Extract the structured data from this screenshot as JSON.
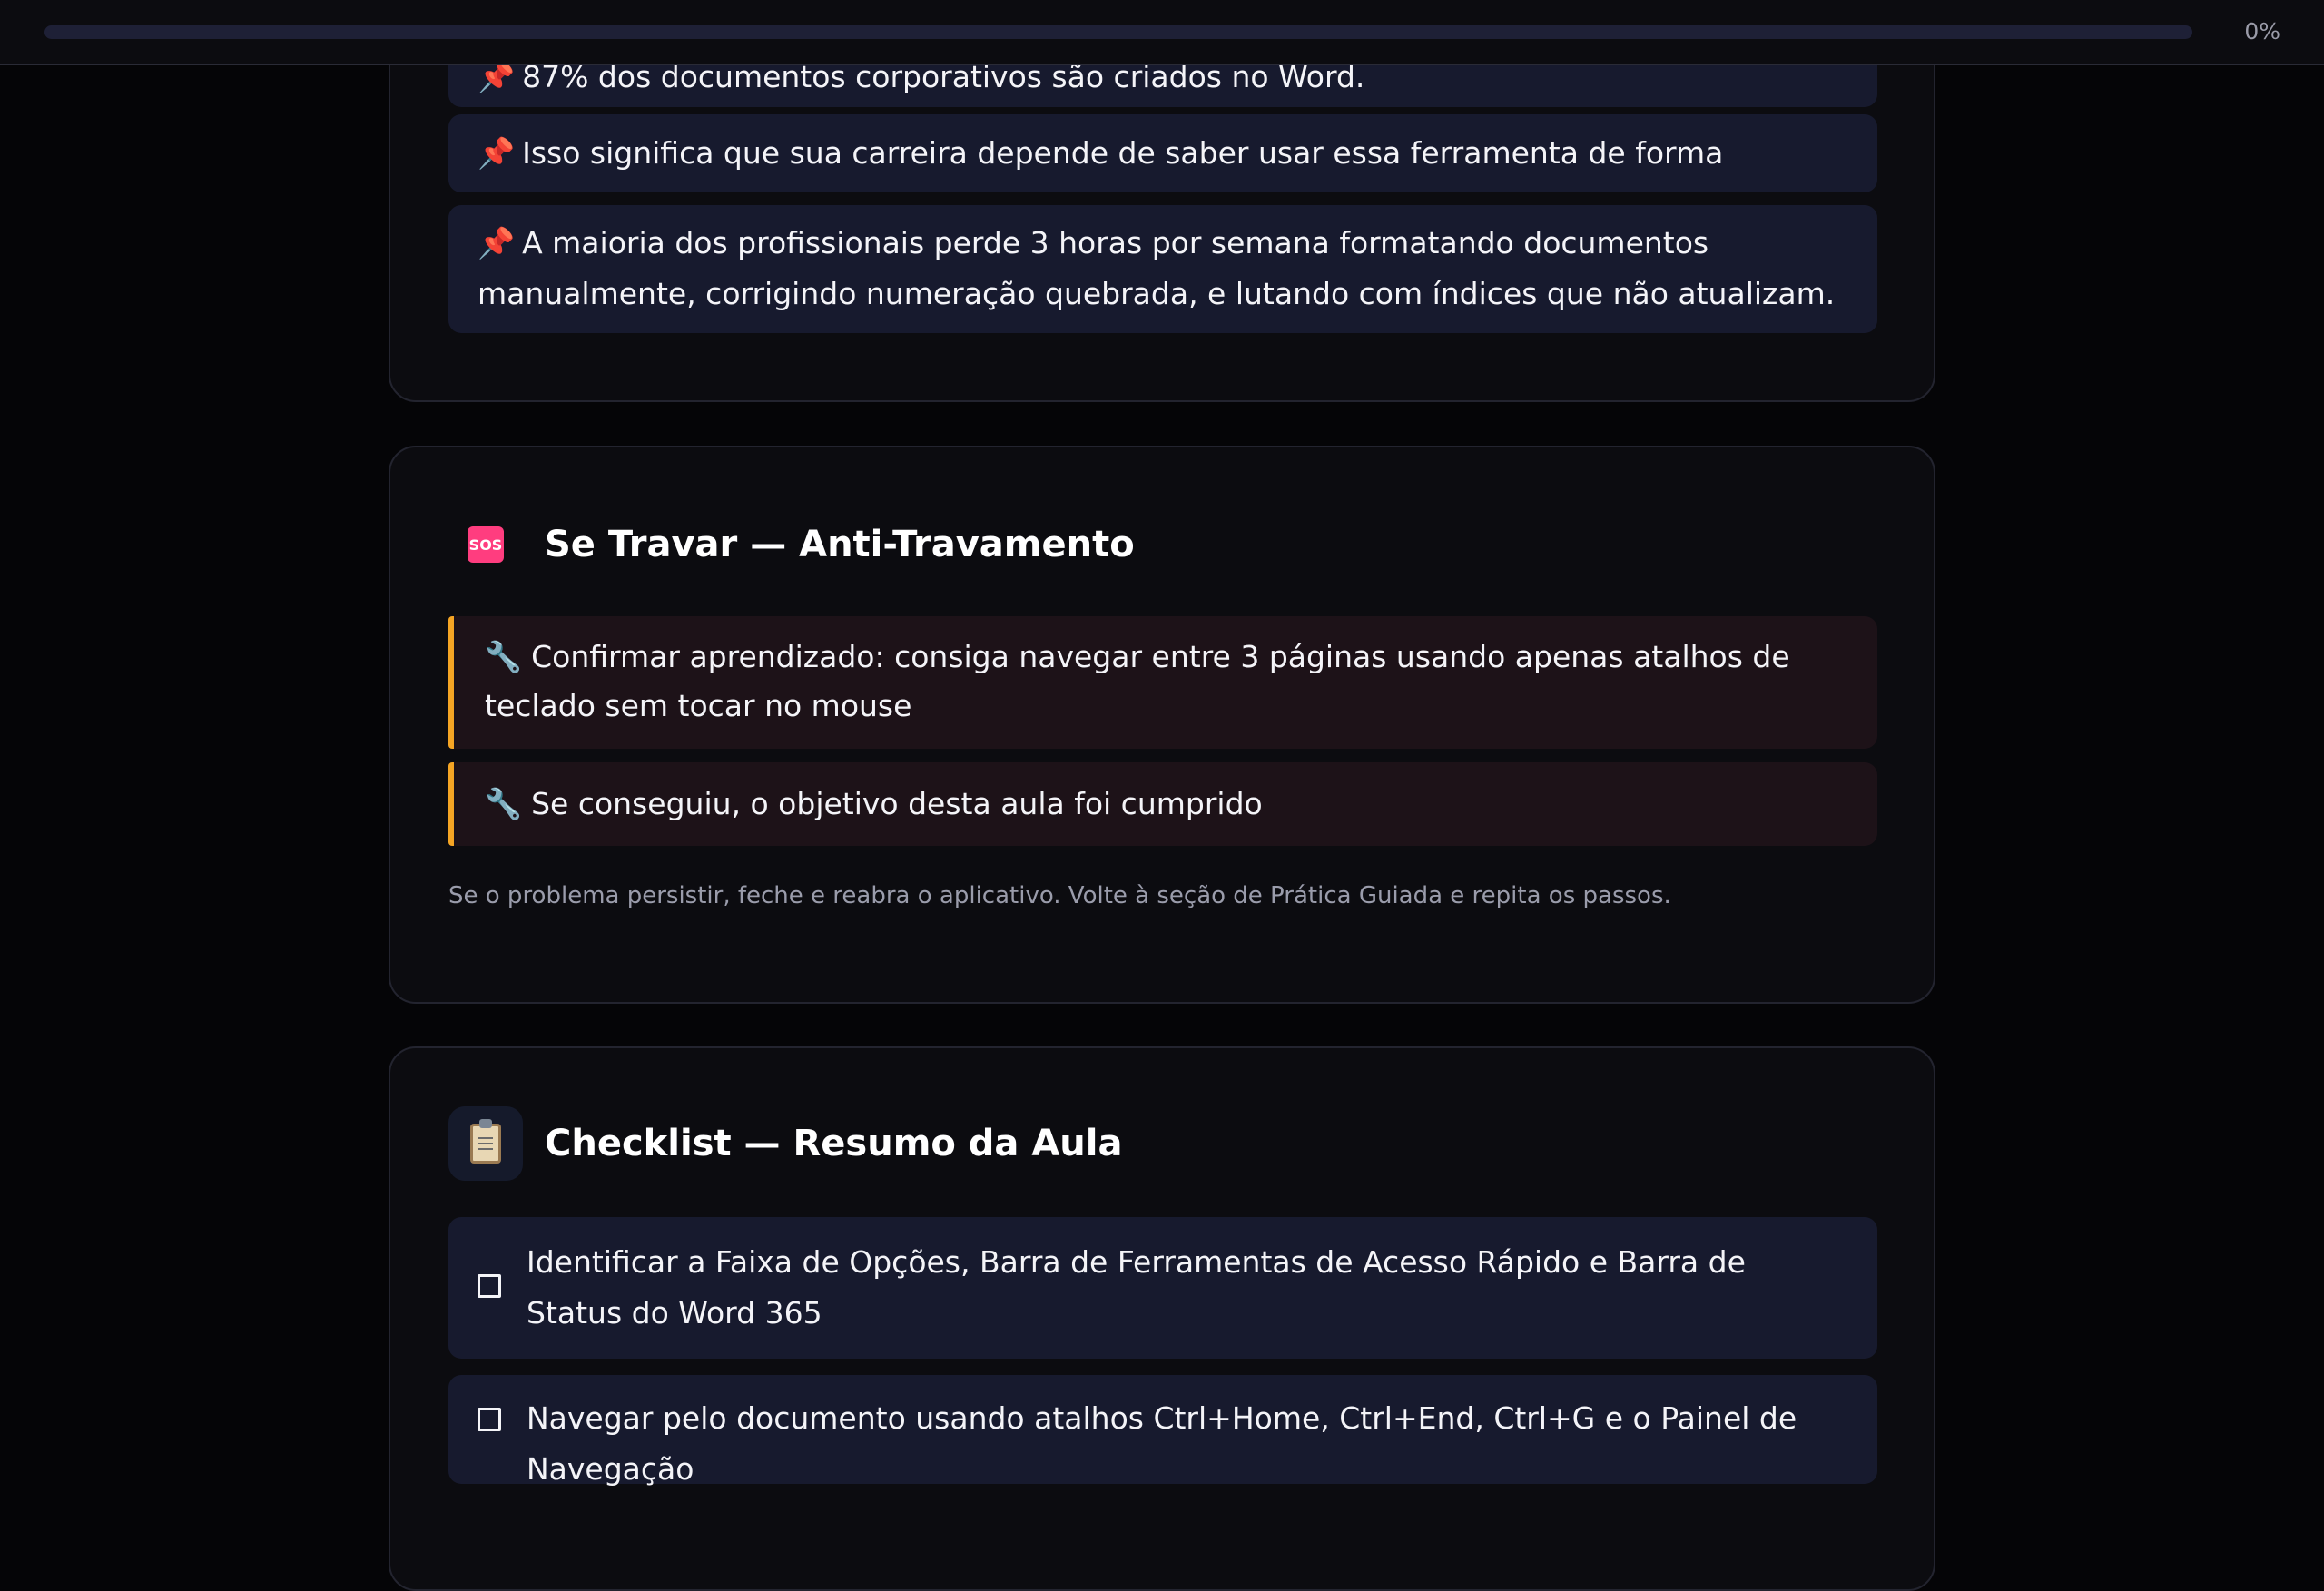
{
  "progress": {
    "percent_label": "0%",
    "value": 0
  },
  "facts": [
    "87% dos documentos corporativos são criados no Word.",
    "Isso significa que sua carreira depende de saber usar essa ferramenta de forma eficiente.",
    "A maioria dos profissionais perde 3 horas por semana formatando documentos manualmente, corrigindo numeração quebrada, e lutando com índices que não atualizam."
  ],
  "fact_icon": "📌",
  "anti_travamento": {
    "icon": "SOS",
    "title": "Se Travar — Anti-Travamento",
    "tips": [
      "Confirmar aprendizado: consiga navegar entre 3 páginas usando apenas atalhos de teclado sem tocar no mouse",
      "Se conseguiu, o objetivo desta aula foi cumprido"
    ],
    "tip_icon": "🔧",
    "note": "Se o problema persistir, feche e reabra o aplicativo. Volte à seção de Prática Guiada e repita os passos."
  },
  "checklist": {
    "title": "Checklist — Resumo da Aula",
    "items": [
      "Identificar a Faixa de Opções, Barra de Ferramentas de Acesso Rápido e Barra de Status do Word 365",
      "Navegar pelo documento usando atalhos Ctrl+Home, Ctrl+End, Ctrl+G e o Painel de Navegação"
    ]
  }
}
